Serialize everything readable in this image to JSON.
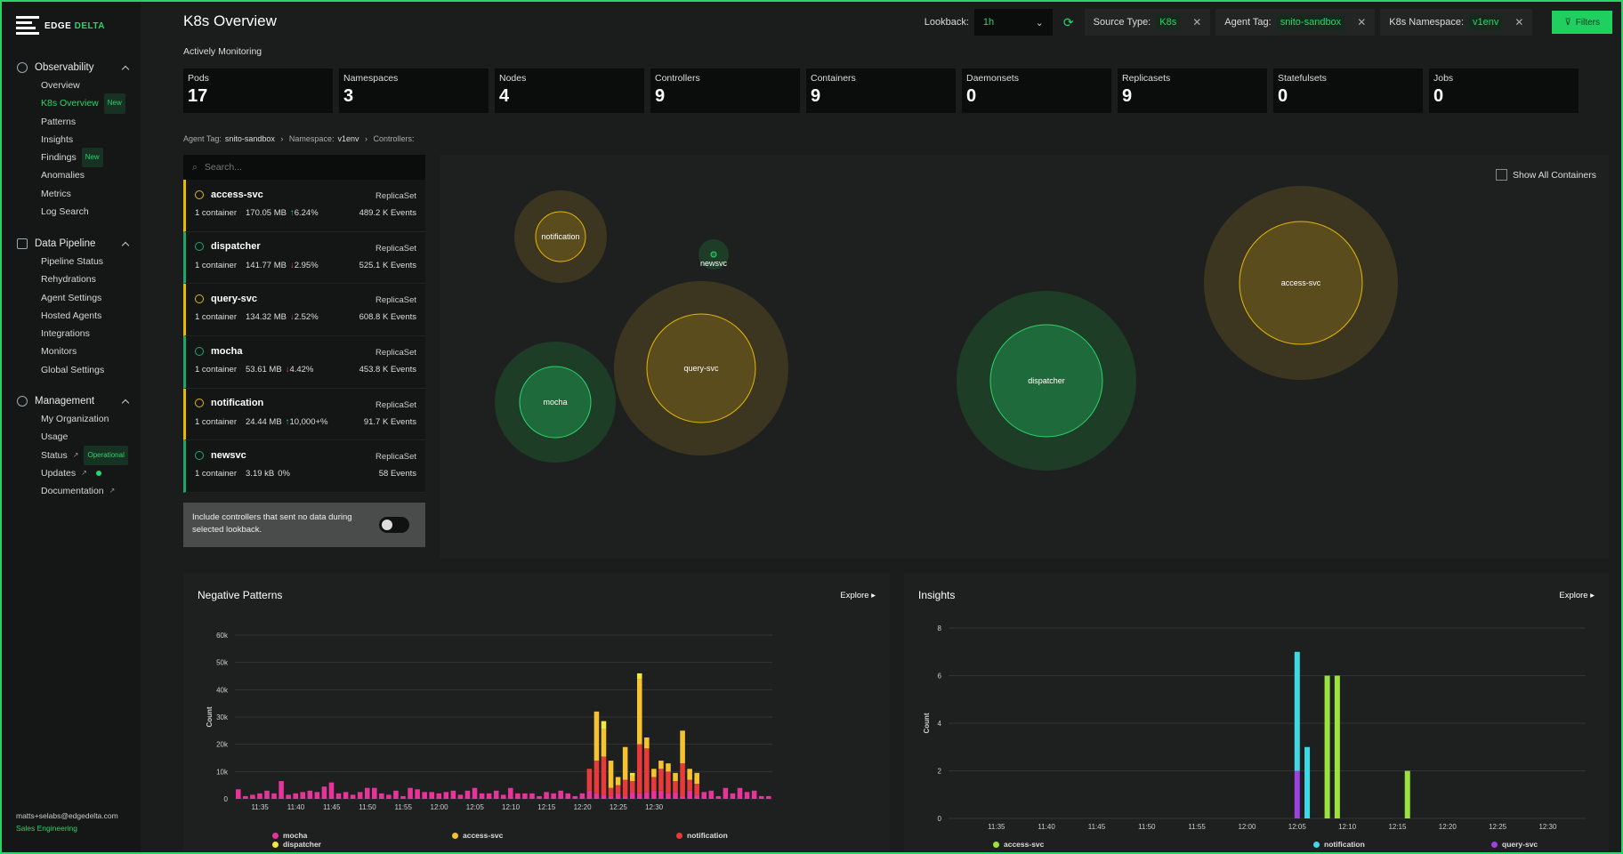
{
  "brand": {
    "name_a": "EDGE",
    "name_b": "DELTA"
  },
  "sidebar": {
    "sections": [
      {
        "title": "Observability",
        "items": [
          {
            "label": "Overview"
          },
          {
            "label": "K8s Overview",
            "badge": "New",
            "active": true
          },
          {
            "label": "Patterns"
          },
          {
            "label": "Insights"
          },
          {
            "label": "Findings",
            "badge": "New"
          },
          {
            "label": "Anomalies"
          },
          {
            "label": "Metrics"
          },
          {
            "label": "Log Search"
          }
        ]
      },
      {
        "title": "Data Pipeline",
        "items": [
          {
            "label": "Pipeline Status"
          },
          {
            "label": "Rehydrations"
          },
          {
            "label": "Agent Settings"
          },
          {
            "label": "Hosted Agents"
          },
          {
            "label": "Integrations"
          },
          {
            "label": "Monitors"
          },
          {
            "label": "Global Settings"
          }
        ]
      },
      {
        "title": "Management",
        "items": [
          {
            "label": "My Organization"
          },
          {
            "label": "Usage"
          },
          {
            "label": "Status",
            "badge": "Operational"
          },
          {
            "label": "Updates"
          },
          {
            "label": "Documentation"
          }
        ]
      }
    ],
    "user_email": "matts+selabs@edgedelta.com",
    "user_role": "Sales Engineering"
  },
  "header": {
    "title": "K8s Overview",
    "subtitle": "Actively Monitoring",
    "lookback_label": "Lookback:",
    "lookback_value": "1h",
    "filters": [
      {
        "label": "Source Type:",
        "value": "K8s"
      },
      {
        "label": "Agent Tag:",
        "value": "snito-sandbox"
      },
      {
        "label": "K8s Namespace:",
        "value": "v1env"
      }
    ],
    "filters_button": "Filters"
  },
  "stats": [
    {
      "label": "Pods",
      "value": "17"
    },
    {
      "label": "Namespaces",
      "value": "3"
    },
    {
      "label": "Nodes",
      "value": "4"
    },
    {
      "label": "Controllers",
      "value": "9"
    },
    {
      "label": "Containers",
      "value": "9"
    },
    {
      "label": "Daemonsets",
      "value": "0"
    },
    {
      "label": "Replicasets",
      "value": "9"
    },
    {
      "label": "Statefulsets",
      "value": "0"
    },
    {
      "label": "Jobs",
      "value": "0"
    }
  ],
  "breadcrumb": {
    "agent_label": "Agent Tag:",
    "agent": "snito-sandbox",
    "ns_label": "Namespace:",
    "ns": "v1env",
    "ctrl_label": "Controllers:"
  },
  "controllers": {
    "search_placeholder": "Search...",
    "items": [
      {
        "name": "access-svc",
        "type": "ReplicaSet",
        "containers": "1 container",
        "mem": "170.05 MB",
        "dir": "up",
        "change": "6.24%",
        "events": "489.2 K Events",
        "status": "warn"
      },
      {
        "name": "dispatcher",
        "type": "ReplicaSet",
        "containers": "1 container",
        "mem": "141.77 MB",
        "dir": "down",
        "change": "2.95%",
        "events": "525.1 K Events",
        "status": "ok"
      },
      {
        "name": "query-svc",
        "type": "ReplicaSet",
        "containers": "1 container",
        "mem": "134.32 MB",
        "dir": "down",
        "change": "2.52%",
        "events": "608.8 K Events",
        "status": "warn"
      },
      {
        "name": "mocha",
        "type": "ReplicaSet",
        "containers": "1 container",
        "mem": "53.61 MB",
        "dir": "down",
        "change": "4.42%",
        "events": "453.8 K Events",
        "status": "ok"
      },
      {
        "name": "notification",
        "type": "ReplicaSet",
        "containers": "1 container",
        "mem": "24.44 MB",
        "dir": "up",
        "change": "10,000+%",
        "events": "91.7 K Events",
        "status": "warn"
      },
      {
        "name": "newsvc",
        "type": "ReplicaSet",
        "containers": "1 container",
        "mem": "3.19 kB",
        "dir": "none",
        "change": "0%",
        "events": "58 Events",
        "status": "ok"
      }
    ],
    "toggle_text": "Include controllers that sent no data during selected lookback."
  },
  "bubbles": {
    "show_all_label": "Show All Containers",
    "items": [
      {
        "name": "notification",
        "status": "warn"
      },
      {
        "name": "newsvc",
        "status": "ok"
      },
      {
        "name": "query-svc",
        "status": "warn"
      },
      {
        "name": "mocha",
        "status": "ok"
      },
      {
        "name": "dispatcher",
        "status": "ok"
      },
      {
        "name": "access-svc",
        "status": "warn"
      }
    ]
  },
  "colors": {
    "green": "#2bd46a",
    "warn": "#e6b800",
    "mocha": "#e8349a",
    "access": "#f5c331",
    "notification": "#e83a3a",
    "dispatcher": "#f1e93b",
    "lime": "#9be23c",
    "cyan": "#3fd9e6",
    "purple": "#9b42e0"
  },
  "chart_data": [
    {
      "type": "bar",
      "title": "Negative Patterns",
      "explore": "Explore",
      "ylabel": "Count",
      "ylim": [
        0,
        60000
      ],
      "yticks": [
        "0",
        "10k",
        "20k",
        "30k",
        "40k",
        "50k",
        "60k"
      ],
      "xticks": [
        "11:35",
        "11:40",
        "11:45",
        "11:50",
        "11:55",
        "12:00",
        "12:05",
        "12:10",
        "12:15",
        "12:20",
        "12:25",
        "12:30"
      ],
      "x_start": "11:32",
      "x_step_minutes": 1,
      "legend": [
        "mocha",
        "access-svc",
        "notification",
        "dispatcher"
      ],
      "series": [
        {
          "name": "mocha",
          "values": [
            3500,
            1000,
            1500,
            2000,
            3000,
            2000,
            6500,
            1500,
            2000,
            2500,
            3000,
            2500,
            4500,
            6000,
            2000,
            2500,
            1500,
            2500,
            4000,
            4000,
            2000,
            1500,
            3000,
            1000,
            4000,
            3500,
            2500,
            2500,
            2000,
            2500,
            3000,
            1500,
            3000,
            4000,
            2000,
            2000,
            3000,
            1500,
            4000,
            2000,
            2000,
            2000,
            1000,
            2500,
            2000,
            3000,
            2000,
            1000,
            2000,
            3000,
            2000,
            1500,
            1000,
            2000,
            1000,
            2500,
            2000,
            2500,
            3000,
            3000,
            2000,
            2500,
            1000,
            3000,
            1500,
            2500,
            3000,
            1000,
            4000,
            2000,
            4000,
            2500,
            3000,
            1000,
            1000
          ]
        },
        {
          "name": "notification",
          "values": [
            0,
            0,
            0,
            0,
            0,
            0,
            0,
            0,
            0,
            0,
            0,
            0,
            0,
            0,
            0,
            0,
            0,
            0,
            0,
            0,
            0,
            0,
            0,
            0,
            0,
            0,
            0,
            0,
            0,
            0,
            0,
            0,
            0,
            0,
            0,
            0,
            0,
            0,
            0,
            0,
            0,
            0,
            0,
            0,
            0,
            0,
            0,
            0,
            0,
            8000,
            12000,
            14000,
            3000,
            3000,
            6000,
            4000,
            18000,
            16000,
            5000,
            8000,
            8000,
            4000,
            12000,
            4000,
            4000,
            0,
            0,
            0,
            0,
            0,
            0,
            0,
            0,
            0,
            0
          ]
        },
        {
          "name": "access-svc",
          "values": [
            0,
            0,
            0,
            0,
            0,
            0,
            0,
            0,
            0,
            0,
            0,
            0,
            0,
            0,
            0,
            0,
            0,
            0,
            0,
            0,
            0,
            0,
            0,
            0,
            0,
            0,
            0,
            0,
            0,
            0,
            0,
            0,
            0,
            0,
            0,
            0,
            0,
            0,
            0,
            0,
            0,
            0,
            0,
            0,
            0,
            0,
            0,
            0,
            0,
            0,
            18000,
            10000,
            10000,
            3000,
            12000,
            2000,
            24000,
            4000,
            3000,
            3000,
            3000,
            3000,
            12000,
            4000,
            4000,
            0,
            0,
            0,
            0,
            0,
            0,
            0,
            0,
            0,
            0
          ]
        },
        {
          "name": "dispatcher",
          "values": [
            0,
            0,
            0,
            0,
            0,
            0,
            0,
            0,
            0,
            0,
            0,
            0,
            0,
            0,
            0,
            0,
            0,
            0,
            0,
            0,
            0,
            0,
            0,
            0,
            0,
            0,
            0,
            0,
            0,
            0,
            0,
            0,
            0,
            0,
            0,
            0,
            0,
            0,
            0,
            0,
            0,
            0,
            0,
            0,
            0,
            0,
            0,
            0,
            0,
            0,
            0,
            3000,
            0,
            0,
            0,
            1000,
            2000,
            0,
            0,
            0,
            0,
            0,
            0,
            0,
            0,
            0,
            0,
            0,
            0,
            0,
            0,
            0,
            0,
            0,
            0
          ]
        }
      ]
    },
    {
      "type": "bar",
      "title": "Insights",
      "explore": "Explore",
      "ylabel": "Count",
      "ylim": [
        0,
        8
      ],
      "yticks": [
        "0",
        "2",
        "4",
        "6",
        "8"
      ],
      "xticks": [
        "11:35",
        "11:40",
        "11:45",
        "11:50",
        "11:55",
        "12:00",
        "12:05",
        "12:10",
        "12:15",
        "12:20",
        "12:25",
        "12:30"
      ],
      "legend": [
        "access-svc",
        "notification",
        "query-svc"
      ],
      "bars": [
        {
          "x": "12:05",
          "query-svc": 2,
          "notification": 5,
          "access-svc": 0
        },
        {
          "x": "12:06",
          "query-svc": 0,
          "notification": 3,
          "access-svc": 0
        },
        {
          "x": "12:08",
          "query-svc": 0,
          "notification": 0,
          "access-svc": 6
        },
        {
          "x": "12:09",
          "query-svc": 0,
          "notification": 0,
          "access-svc": 6
        },
        {
          "x": "12:16",
          "query-svc": 0,
          "notification": 0,
          "access-svc": 2
        }
      ]
    }
  ]
}
